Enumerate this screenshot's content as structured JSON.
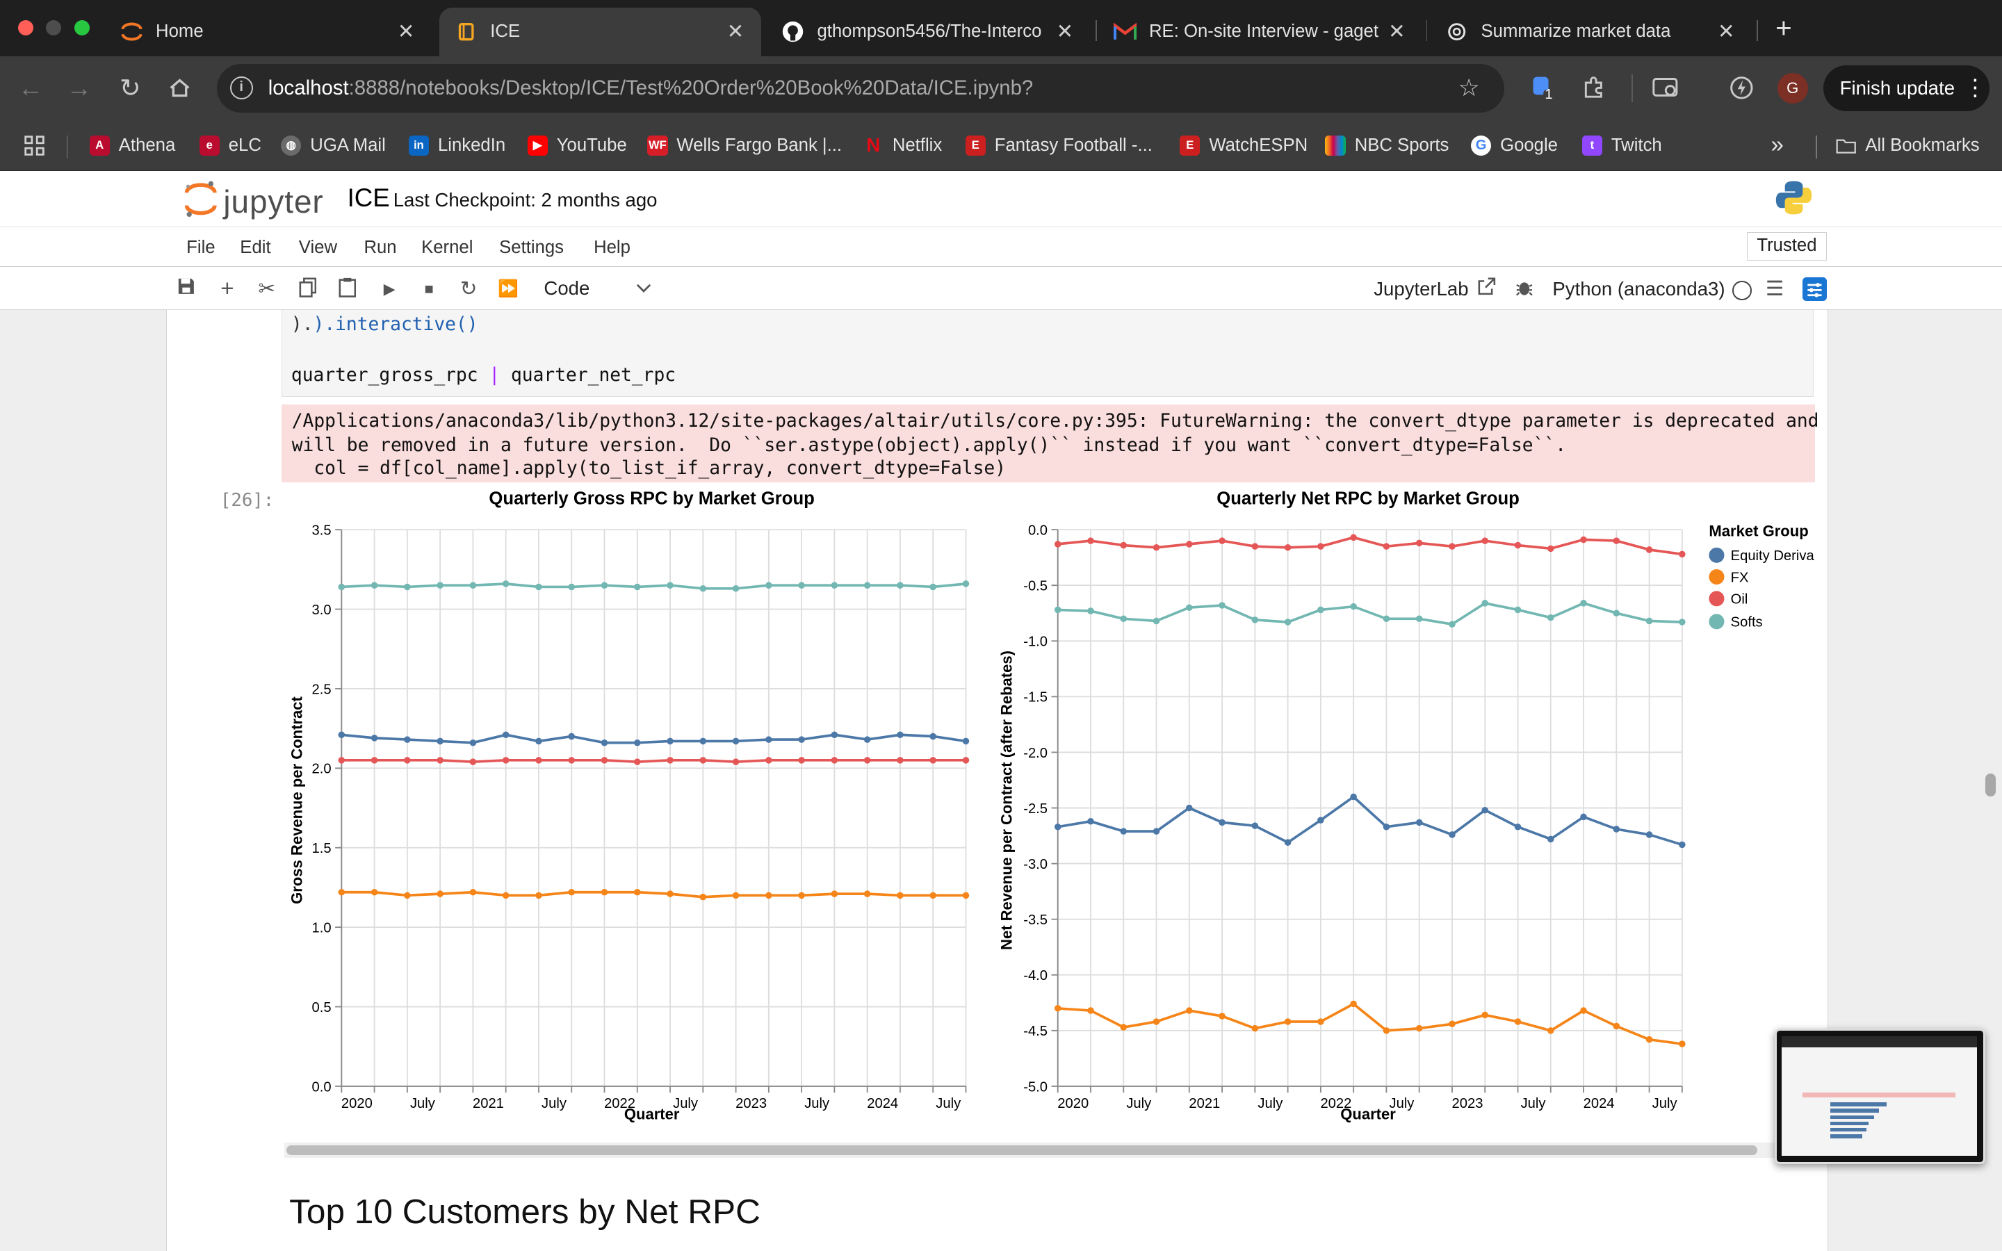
{
  "browser": {
    "tabs": [
      {
        "label": "Home",
        "icon": "jupyter-logo-icon",
        "active": false
      },
      {
        "label": "ICE",
        "icon": "book-icon",
        "active": true
      },
      {
        "label": "gthompson5456/The-Interco",
        "icon": "github-icon",
        "active": false
      },
      {
        "label": "RE: On-site Interview - gaget",
        "icon": "gmail-icon",
        "active": false
      },
      {
        "label": "Summarize market data",
        "icon": "chatgpt-icon",
        "active": false
      }
    ],
    "url_host": "localhost",
    "url_rest": ":8888/notebooks/Desktop/ICE/Test%20Order%20Book%20Data/ICE.ipynb?",
    "extension_badge": "1",
    "profile_initial": "G",
    "finish_update": "Finish update",
    "bookmarks": [
      "Athena",
      "eLC",
      "UGA Mail",
      "LinkedIn",
      "YouTube",
      "Wells Fargo Bank |...",
      "Netflix",
      "Fantasy Football -...",
      "WatchESPN",
      "NBC Sports",
      "Google",
      "Twitch"
    ],
    "all_bookmarks": "All Bookmarks",
    "overflow": "»"
  },
  "jupyter": {
    "logo_text": "jupyter",
    "notebook_name": "ICE",
    "checkpoint": "Last Checkpoint: 2 months ago",
    "menu": [
      "File",
      "Edit",
      "View",
      "Run",
      "Kernel",
      "Settings",
      "Help"
    ],
    "trusted": "Trusted",
    "cell_type": "Code",
    "jupyterlab": "JupyterLab",
    "kernel": "Python (anaconda3)"
  },
  "cell": {
    "code_line1": ").interactive()",
    "code_line2_a": "quarter_gross_rpc ",
    "code_line2_pipe": "|",
    "code_line2_b": " quarter_net_rpc",
    "warning_line1": "/Applications/anaconda3/lib/python3.12/site-packages/altair/utils/core.py:395: FutureWarning: the convert_dtype parameter is deprecated and",
    "warning_line2": "will be removed in a future version.  Do ``ser.astype(object).apply()`` instead if you want ``convert_dtype=False``.",
    "warning_line3": "  col = df[col_name].apply(to_list_if_array, convert_dtype=False)",
    "prompt": "[26]:",
    "next_heading": "Top 10 Customers by Net RPC"
  },
  "legend": {
    "title": "Market Group",
    "entries": [
      "Equity Deriva",
      "FX",
      "Oil",
      "Softs"
    ]
  },
  "colors": {
    "Equity Derivatives": "#4c78a8",
    "FX": "#f58518",
    "Oil": "#e45756",
    "Softs": "#72b7b2"
  },
  "chart_data": [
    {
      "type": "line",
      "title": "Quarterly Gross RPC by Market Group",
      "xlabel": "Quarter",
      "ylabel": "Gross Revenue per Contract",
      "x": [
        "2020 Q1",
        "2020 Q2",
        "2020 Q3",
        "2020 Q4",
        "2021 Q1",
        "2021 Q2",
        "2021 Q3",
        "2021 Q4",
        "2022 Q1",
        "2022 Q2",
        "2022 Q3",
        "2022 Q4",
        "2023 Q1",
        "2023 Q2",
        "2023 Q3",
        "2023 Q4",
        "2024 Q1",
        "2024 Q2",
        "2024 Q3",
        "2024 Q4"
      ],
      "x_ticks": [
        "2020",
        "July",
        "2021",
        "July",
        "2022",
        "July",
        "2023",
        "July",
        "2024",
        "July"
      ],
      "y_ticks": [
        "0.0",
        "0.5",
        "1.0",
        "1.5",
        "2.0",
        "2.5",
        "3.0",
        "3.5"
      ],
      "ylim": [
        0,
        3.5
      ],
      "grid": true,
      "series": [
        {
          "name": "Equity Derivatives",
          "values": [
            2.21,
            2.19,
            2.18,
            2.17,
            2.16,
            2.21,
            2.17,
            2.2,
            2.16,
            2.16,
            2.17,
            2.17,
            2.17,
            2.18,
            2.18,
            2.21,
            2.18,
            2.21,
            2.2,
            2.17
          ]
        },
        {
          "name": "FX",
          "values": [
            1.22,
            1.22,
            1.2,
            1.21,
            1.22,
            1.2,
            1.2,
            1.22,
            1.22,
            1.22,
            1.21,
            1.19,
            1.2,
            1.2,
            1.2,
            1.21,
            1.21,
            1.2,
            1.2,
            1.2
          ]
        },
        {
          "name": "Oil",
          "values": [
            2.05,
            2.05,
            2.05,
            2.05,
            2.04,
            2.05,
            2.05,
            2.05,
            2.05,
            2.04,
            2.05,
            2.05,
            2.04,
            2.05,
            2.05,
            2.05,
            2.05,
            2.05,
            2.05,
            2.05
          ]
        },
        {
          "name": "Softs",
          "values": [
            3.14,
            3.15,
            3.14,
            3.15,
            3.15,
            3.16,
            3.14,
            3.14,
            3.15,
            3.14,
            3.15,
            3.13,
            3.13,
            3.15,
            3.15,
            3.15,
            3.15,
            3.15,
            3.14,
            3.16
          ]
        }
      ]
    },
    {
      "type": "line",
      "title": "Quarterly Net RPC by Market Group",
      "xlabel": "Quarter",
      "ylabel": "Net Revenue per Contract (after Rebates)",
      "x": [
        "2020 Q1",
        "2020 Q2",
        "2020 Q3",
        "2020 Q4",
        "2021 Q1",
        "2021 Q2",
        "2021 Q3",
        "2021 Q4",
        "2022 Q1",
        "2022 Q2",
        "2022 Q3",
        "2022 Q4",
        "2023 Q1",
        "2023 Q2",
        "2023 Q3",
        "2023 Q4",
        "2024 Q1",
        "2024 Q2",
        "2024 Q3",
        "2024 Q4"
      ],
      "x_ticks": [
        "2020",
        "July",
        "2021",
        "July",
        "2022",
        "July",
        "2023",
        "July",
        "2024",
        "July"
      ],
      "y_ticks": [
        "0.0",
        "-0.5",
        "-1.0",
        "-1.5",
        "-2.0",
        "-2.5",
        "-3.0",
        "-3.5",
        "-4.0",
        "-4.5",
        "-5.0"
      ],
      "ylim": [
        -5,
        0
      ],
      "grid": true,
      "legend": "right",
      "series": [
        {
          "name": "Equity Derivatives",
          "values": [
            -2.67,
            -2.62,
            -2.71,
            -2.71,
            -2.5,
            -2.63,
            -2.66,
            -2.81,
            -2.61,
            -2.4,
            -2.67,
            -2.63,
            -2.74,
            -2.52,
            -2.67,
            -2.78,
            -2.58,
            -2.69,
            -2.74,
            -2.83
          ]
        },
        {
          "name": "FX",
          "values": [
            -4.3,
            -4.32,
            -4.47,
            -4.42,
            -4.32,
            -4.37,
            -4.48,
            -4.42,
            -4.42,
            -4.26,
            -4.5,
            -4.48,
            -4.44,
            -4.36,
            -4.42,
            -4.5,
            -4.32,
            -4.46,
            -4.58,
            -4.62
          ]
        },
        {
          "name": "Oil",
          "values": [
            -0.13,
            -0.1,
            -0.14,
            -0.16,
            -0.13,
            -0.1,
            -0.15,
            -0.16,
            -0.15,
            -0.07,
            -0.15,
            -0.12,
            -0.15,
            -0.1,
            -0.14,
            -0.17,
            -0.09,
            -0.1,
            -0.18,
            -0.22
          ]
        },
        {
          "name": "Softs",
          "values": [
            -0.72,
            -0.73,
            -0.8,
            -0.82,
            -0.7,
            -0.68,
            -0.81,
            -0.83,
            -0.72,
            -0.69,
            -0.8,
            -0.8,
            -0.85,
            -0.66,
            -0.72,
            -0.79,
            -0.66,
            -0.75,
            -0.82,
            -0.83
          ]
        }
      ]
    }
  ]
}
